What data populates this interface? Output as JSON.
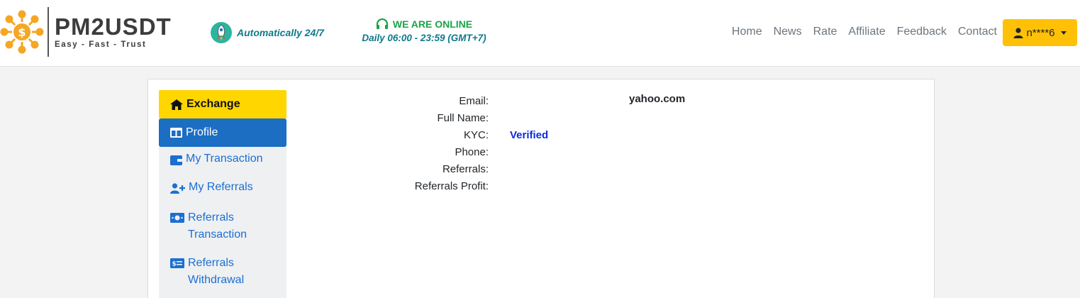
{
  "brand": {
    "name": "PM2USDT",
    "tagline": "Easy - Fast - Trust",
    "logo_icon": "gear-coin-icon",
    "accent": "#f5a623"
  },
  "header": {
    "auto_label": "Automatically 24/7",
    "auto_icon": "rocket-icon",
    "online_label": "WE ARE ONLINE",
    "online_icon": "headset-icon",
    "online_hours": "Daily 06:00 - 23:59 (GMT+7)"
  },
  "nav": {
    "home": "Home",
    "news": "News",
    "rate": "Rate",
    "affiliate": "Affiliate",
    "feedback": "Feedback",
    "contact": "Contact"
  },
  "user": {
    "name": "n****6",
    "icon": "user-icon"
  },
  "sidebar": {
    "exchange": "Exchange",
    "profile": "Profile",
    "my_transaction": "My Transaction",
    "my_referrals": "My Referrals",
    "referrals_transaction_1": "Referrals",
    "referrals_transaction_2": "Transaction",
    "referrals_withdrawal_1": "Referrals",
    "referrals_withdrawal_2": "Withdrawal"
  },
  "profile": {
    "email_label": "Email:",
    "email_value": "yahoo.com",
    "fullname_label": "Full Name:",
    "kyc_label": "KYC:",
    "kyc_value": "Verified",
    "phone_label": "Phone:",
    "referrals_label": "Referrals:",
    "referrals_profit_label": "Referrals Profit:"
  },
  "colors": {
    "exchange_bg": "#ffd600",
    "profile_bg": "#1b6ec2",
    "user_btn": "#ffc107",
    "online_green": "#1aa34a",
    "teal_text": "#0f7a8a",
    "verified_blue": "#0d2be0"
  }
}
